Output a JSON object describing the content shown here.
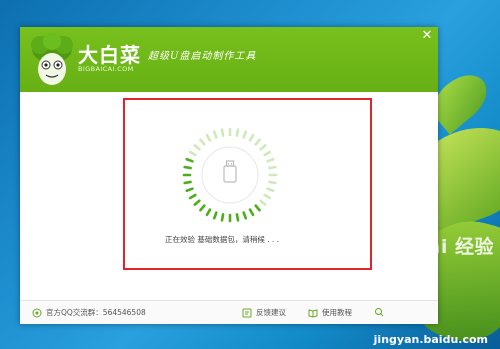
{
  "window": {
    "brand_name": "大白菜",
    "brand_domain": "BIGBAICAI.COM",
    "slogan": "超级U盘启动制作工具",
    "close_glyph": "✕"
  },
  "main": {
    "status_text": "正在效验 基础数据包，请稍候 . . ."
  },
  "footer": {
    "qq_group_label": "官方QQ交流群：564546508",
    "feedback_label": "反馈建议",
    "tutorial_label": "使用教程"
  },
  "desktop": {
    "watermark": "Bai 经验",
    "watermark_url": "jingyan.baidu.com"
  },
  "colors": {
    "header_green": "#72b819",
    "highlight_red": "#e0262b",
    "spinner_active": "#4caf1a",
    "spinner_fade": "#cfe9bb"
  }
}
